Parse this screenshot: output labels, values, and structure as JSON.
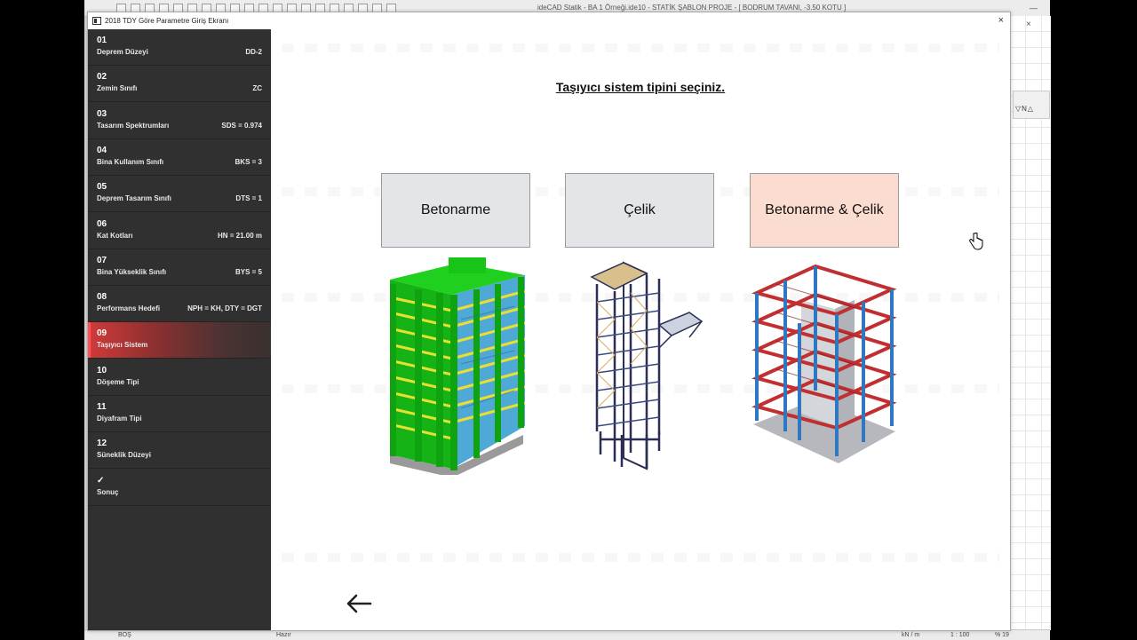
{
  "app": {
    "title": "ideCAD Statik - BA 1 Örneği.ide10 - STATİK ŞABLON PROJE - [ BODRUM TAVANI, -3.50 KOTU ]",
    "status_left": "BOŞ",
    "status_mid": "Hazır",
    "status_units": "kN / m",
    "status_scale": "1 : 100",
    "status_zoom": "% 19"
  },
  "dialog": {
    "title": "2018 TDY Göre Parametre Giriş Ekranı",
    "close_label": "×"
  },
  "steps": [
    {
      "num": "01",
      "label": "Deprem Düzeyi",
      "value": "DD-2"
    },
    {
      "num": "02",
      "label": "Zemin Sınıfı",
      "value": "ZC"
    },
    {
      "num": "03",
      "label": "Tasarım Spektrumları",
      "value": "SDS = 0.974"
    },
    {
      "num": "04",
      "label": "Bina Kullanım Sınıfı",
      "value": "BKS = 3"
    },
    {
      "num": "05",
      "label": "Deprem Tasarım Sınıfı",
      "value": "DTS = 1"
    },
    {
      "num": "06",
      "label": "Kat Kotları",
      "value": "HN = 21.00 m"
    },
    {
      "num": "07",
      "label": "Bina Yükseklik Sınıfı",
      "value": "BYS = 5"
    },
    {
      "num": "08",
      "label": "Performans Hedefi",
      "value": "NPH = KH, DTY = DGT"
    },
    {
      "num": "09",
      "label": "Taşıyıcı Sistem",
      "value": ""
    },
    {
      "num": "10",
      "label": "Döşeme Tipi",
      "value": ""
    },
    {
      "num": "11",
      "label": "Diyafram Tipi",
      "value": ""
    },
    {
      "num": "12",
      "label": "Süneklik Düzeyi",
      "value": ""
    },
    {
      "num": "✓",
      "label": "Sonuç",
      "value": ""
    }
  ],
  "active_step": "09",
  "main": {
    "question": "Taşıyıcı sistem tipini seçiniz.",
    "options": [
      {
        "label": "Betonarme",
        "illustration": "reinforced-concrete-building"
      },
      {
        "label": "Çelik",
        "illustration": "steel-frame-building"
      },
      {
        "label": "Betonarme & Çelik",
        "illustration": "composite-building"
      }
    ],
    "hovered_option": "Betonarme & Çelik",
    "back_icon": "arrow-left-icon"
  },
  "colors": {
    "sidebar_bg": "#303030",
    "active_step_accent": "#d23a3a",
    "option_bg": "#e4e5e8",
    "option_hover_bg": "#fbdcd0",
    "concrete_green": "#18c418",
    "beam_yellow": "#e8e030",
    "steel_blue": "#2f78c0",
    "steel_red": "#c83030"
  }
}
